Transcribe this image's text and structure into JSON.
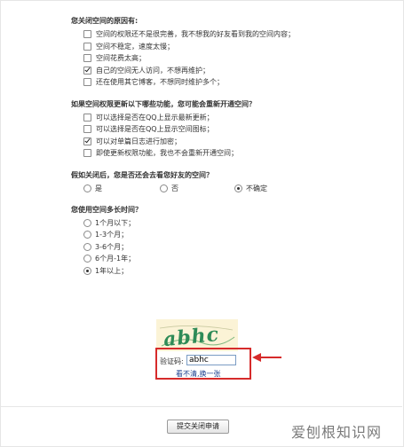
{
  "sections": [
    {
      "question": "您关闭空间的原因有:",
      "type": "checkbox",
      "options": [
        {
          "label": "空间的权限还不是很完善，我不想我的好友看到我的空间内容；",
          "checked": false
        },
        {
          "label": "空间不稳定，速度太慢；",
          "checked": false
        },
        {
          "label": "空间花费太高；",
          "checked": false
        },
        {
          "label": "自己的空间无人访问，不想再维护；",
          "checked": true
        },
        {
          "label": "还在使用其它博客，不想同时维护多个；",
          "checked": false
        }
      ]
    },
    {
      "question": "如果空间权限更新以下哪些功能，您可能会重新开通空间？",
      "type": "checkbox",
      "options": [
        {
          "label": "可以选择是否在QQ上显示最新更新；",
          "checked": false
        },
        {
          "label": "可以选择是否在QQ上显示空间图标；",
          "checked": false
        },
        {
          "label": "可以对单篇日志进行加密；",
          "checked": true
        },
        {
          "label": "即使更新权限功能，我也不会重新开通空间；",
          "checked": false
        }
      ]
    },
    {
      "question": "假如关闭后，您是否还会去看您好友的空间？",
      "type": "radio-inline",
      "options": [
        {
          "label": "是",
          "checked": false
        },
        {
          "label": "否",
          "checked": false
        },
        {
          "label": "不确定",
          "checked": true
        }
      ]
    },
    {
      "question": "您使用空间多长时间？",
      "type": "radio",
      "options": [
        {
          "label": "1个月以下；",
          "checked": false
        },
        {
          "label": "1-3个月；",
          "checked": false
        },
        {
          "label": "3-6个月；",
          "checked": false
        },
        {
          "label": "6个月-1年；",
          "checked": false
        },
        {
          "label": "1年以上；",
          "checked": true
        }
      ]
    }
  ],
  "captcha": {
    "image_text": "abhc",
    "label": "验证码:",
    "value": "abhc",
    "refresh_link": "看不清,换一张"
  },
  "submit_label": "提交关闭申请",
  "watermark": "爱刨根知识网",
  "colors": {
    "highlight_box": "#d62b2b",
    "link": "#1b3f8f",
    "captcha_text": "#2e8b57",
    "captcha_bg": "#fbf3d6"
  }
}
